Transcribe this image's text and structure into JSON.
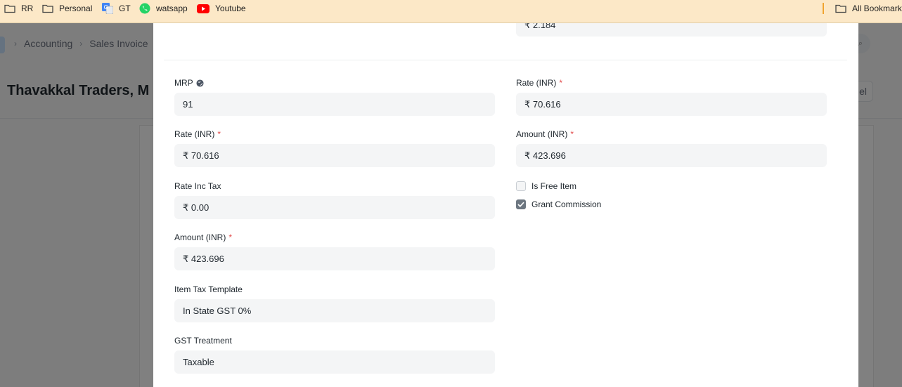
{
  "bookmarks": {
    "items": [
      {
        "label": "RR",
        "icon": "folder-icon"
      },
      {
        "label": "Personal",
        "icon": "folder-icon"
      },
      {
        "label": "GT",
        "icon": "google-translate-icon"
      },
      {
        "label": "watsapp",
        "icon": "whatsapp-icon"
      },
      {
        "label": "Youtube",
        "icon": "youtube-icon"
      }
    ],
    "all_bookmarks": "All Bookmarks"
  },
  "background": {
    "breadcrumb": [
      "Accounting",
      "Sales Invoice"
    ],
    "title": "Thavakkal Traders, M",
    "button_label": "el"
  },
  "form": {
    "top_partial_value": "₹ 2.184",
    "mrp": {
      "label": "MRP",
      "value": "91"
    },
    "rate_left": {
      "label": "Rate (INR)",
      "required": "*",
      "value": "₹ 70.616"
    },
    "rate_inc_tax": {
      "label": "Rate Inc Tax",
      "value": "₹ 0.00"
    },
    "amount_left": {
      "label": "Amount (INR)",
      "required": "*",
      "value": "₹ 423.696"
    },
    "item_tax_template": {
      "label": "Item Tax Template",
      "value": "In State GST 0%"
    },
    "gst_treatment": {
      "label": "GST Treatment",
      "value": "Taxable"
    },
    "rate_right": {
      "label": "Rate (INR)",
      "required": "*",
      "value": "₹ 70.616"
    },
    "amount_right": {
      "label": "Amount (INR)",
      "required": "*",
      "value": "₹ 423.696"
    },
    "is_free_item": {
      "label": "Is Free Item",
      "checked": false
    },
    "grant_commission": {
      "label": "Grant Commission",
      "checked": true
    }
  },
  "colors": {
    "bookmarks_bar": "#fce8c7",
    "required_marker": "#e24c4c",
    "input_bg": "#f4f5f6",
    "youtube_red": "#ff0000",
    "whatsapp_green": "#25d366"
  }
}
